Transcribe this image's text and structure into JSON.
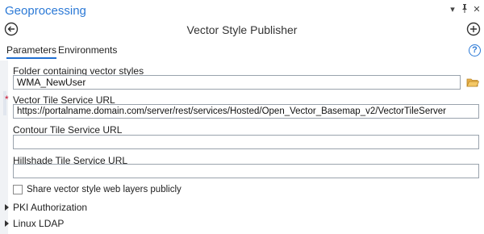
{
  "pane": {
    "title": "Geoprocessing",
    "controls": {
      "options_glyph": "▾",
      "pin_glyph": "📌",
      "close_glyph": "✕"
    }
  },
  "toolbar": {
    "title": "Vector Style Publisher",
    "back_icon": "back-arrow-circle-icon",
    "add_icon": "add-plus-circle-icon"
  },
  "tabs": [
    {
      "label": "Parameters",
      "active": true
    },
    {
      "label": "Environments",
      "active": false
    }
  ],
  "help_glyph": "?",
  "params": {
    "folder": {
      "label": "Folder containing vector styles",
      "value": "WMA_NewUser"
    },
    "vector_tile": {
      "label": "Vector Tile Service URL",
      "value": "https://portalname.domain.com/server/rest/services/Hosted/Open_Vector_Basemap_v2/VectorTileServer",
      "required_mark": "*"
    },
    "contour": {
      "label": "Contour Tile Service URL",
      "value": ""
    },
    "hillshade": {
      "label": "Hillshade Tile Service URL",
      "value": ""
    },
    "share": {
      "label": "Share vector style web layers publicly",
      "checked": false
    }
  },
  "groups": [
    {
      "label": "PKI Authorization"
    },
    {
      "label": "Linux LDAP"
    }
  ],
  "colors": {
    "accent": "#2b79d6",
    "required": "#c8102e",
    "folder": "#e8b04a"
  }
}
